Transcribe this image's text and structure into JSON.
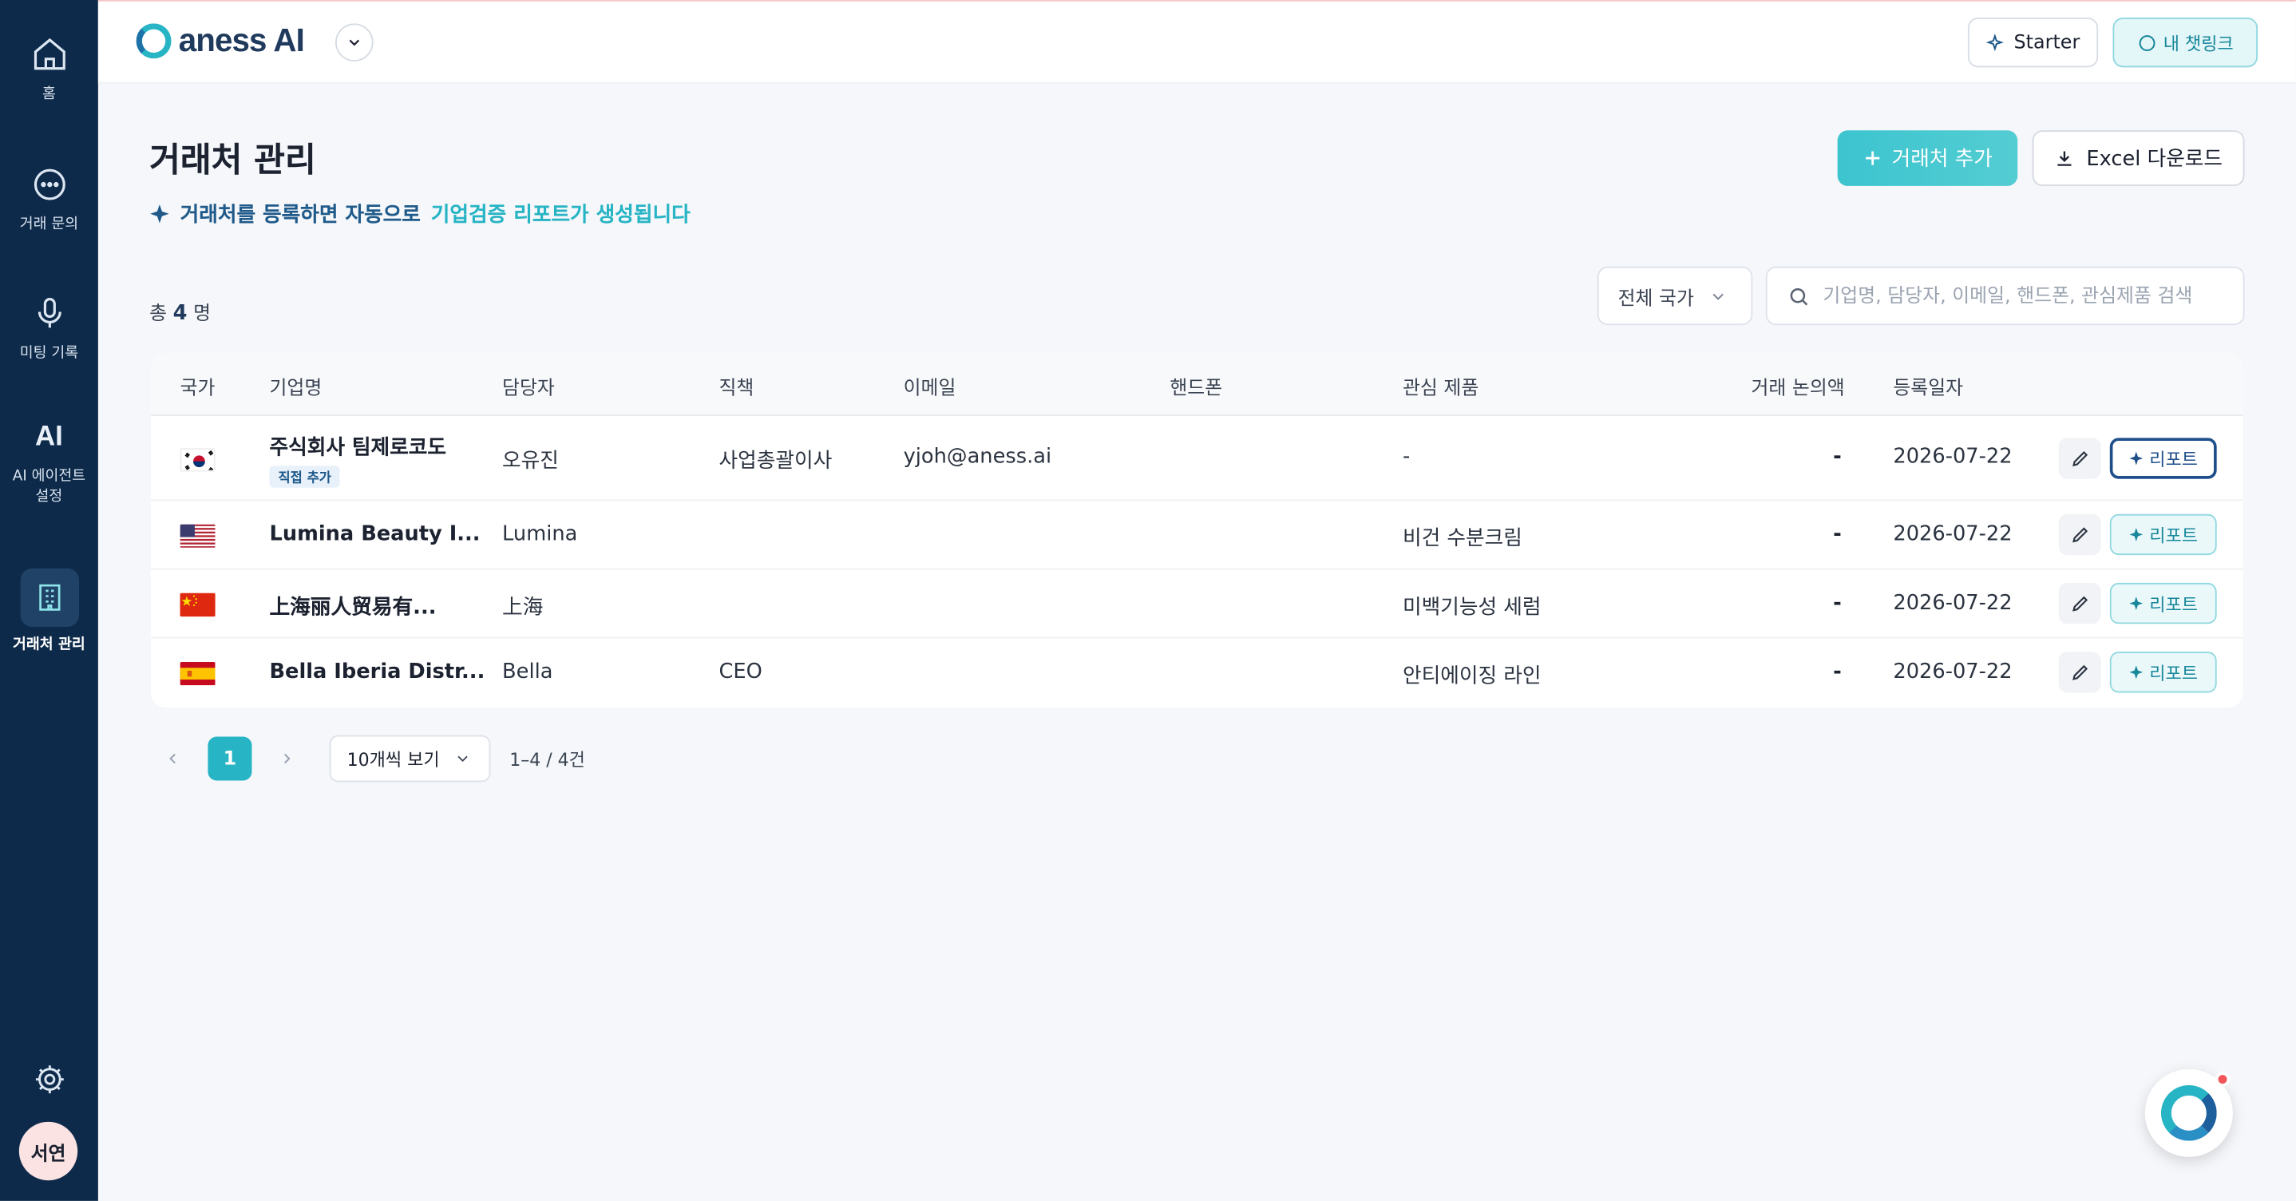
{
  "sidebar": {
    "items": [
      {
        "label": "홈",
        "icon": "home-icon"
      },
      {
        "label": "거래 문의",
        "icon": "chat-bubble-icon"
      },
      {
        "label": "미팅 기록",
        "icon": "microphone-icon"
      },
      {
        "label": "AI 에이전트\n설정",
        "icon": "ai-icon",
        "mark": "AI"
      },
      {
        "label": "거래처 관리",
        "icon": "building-icon",
        "active": true
      }
    ],
    "settings_icon": "gear-icon",
    "avatar": "서연"
  },
  "topbar": {
    "logo_text": "aness AI",
    "starter_label": "Starter",
    "chatlink_label": "내 챗링크"
  },
  "page": {
    "title": "거래처 관리",
    "subtitle_part1": "거래처를 등록하면 자동으로",
    "subtitle_part2": "기업검증 리포트가 생성됩니다",
    "add_button": "거래처 추가",
    "excel_button": "Excel 다운로드",
    "total_prefix": "총",
    "total_count": "4",
    "total_suffix": "명",
    "country_filter": "전체 국가",
    "search_placeholder": "기업명, 담당자, 이메일, 핸드폰, 관심제품 검색"
  },
  "table": {
    "headers": [
      "국가",
      "기업명",
      "담당자",
      "직책",
      "이메일",
      "핸드폰",
      "관심 제품",
      "거래 논의액",
      "등록일자"
    ],
    "rows": [
      {
        "flag": "kr",
        "company": "주식회사 팀제로코도",
        "badge": "직접 추가",
        "contact": "오유진",
        "position": "사업총괄이사",
        "email": "yjoh@aness.ai",
        "phone": "",
        "product": "-",
        "amount": "-",
        "date": "2026-07-22",
        "report": "리포트"
      },
      {
        "flag": "us",
        "company": "Lumina Beauty I...",
        "badge": "",
        "contact": "Lumina",
        "position": "",
        "email": "",
        "phone": "",
        "product": "비건 수분크림",
        "amount": "-",
        "date": "2026-07-22",
        "report": "리포트"
      },
      {
        "flag": "cn",
        "company": "上海丽人贸易有...",
        "badge": "",
        "contact": "上海",
        "position": "",
        "email": "",
        "phone": "",
        "product": "미백기능성 세럼",
        "amount": "-",
        "date": "2026-07-22",
        "report": "리포트"
      },
      {
        "flag": "es",
        "company": "Bella Iberia Distr...",
        "badge": "",
        "contact": "Bella",
        "position": "CEO",
        "email": "",
        "phone": "",
        "product": "안티에이징 라인",
        "amount": "-",
        "date": "2026-07-22",
        "report": "리포트"
      }
    ]
  },
  "pagination": {
    "current_page": "1",
    "per_page": "10개씩 보기",
    "range": "1–4 / 4건"
  },
  "colors": {
    "sidebar_bg": "#0e2a4a",
    "accent_teal": "#27b4c4",
    "accent_navy": "#1f5a8a"
  }
}
